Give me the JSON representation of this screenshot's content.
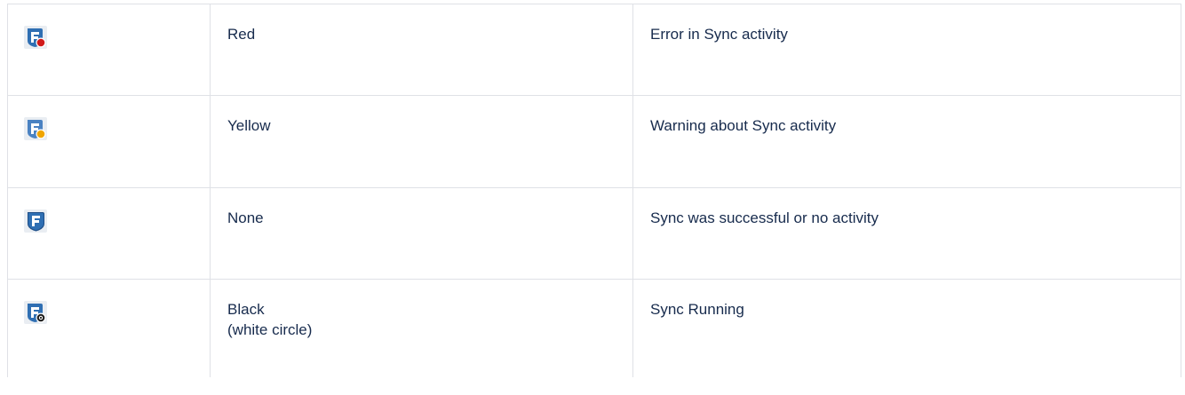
{
  "rows": [
    {
      "icon": "sync-error-icon",
      "color": "Red",
      "description": "Error in Sync activity",
      "badge_color": "#d11a1a"
    },
    {
      "icon": "sync-warning-icon",
      "color": "Yellow",
      "description": "Warning about Sync activity",
      "badge_color": "#f0a500"
    },
    {
      "icon": "sync-success-icon",
      "color": "None",
      "description": "Sync was successful or no activity",
      "badge_color": ""
    },
    {
      "icon": "sync-running-icon",
      "color": "Black",
      "color_note": "(white circle)",
      "description": "Sync Running",
      "badge_color": "#1d1d1d"
    }
  ],
  "colors": {
    "icon_blue": "#2f6fb3",
    "icon_blue_dark": "#1f4f88",
    "icon_bg": "#e9edf2",
    "border": "#dfe1e6",
    "text": "#172b4d"
  }
}
